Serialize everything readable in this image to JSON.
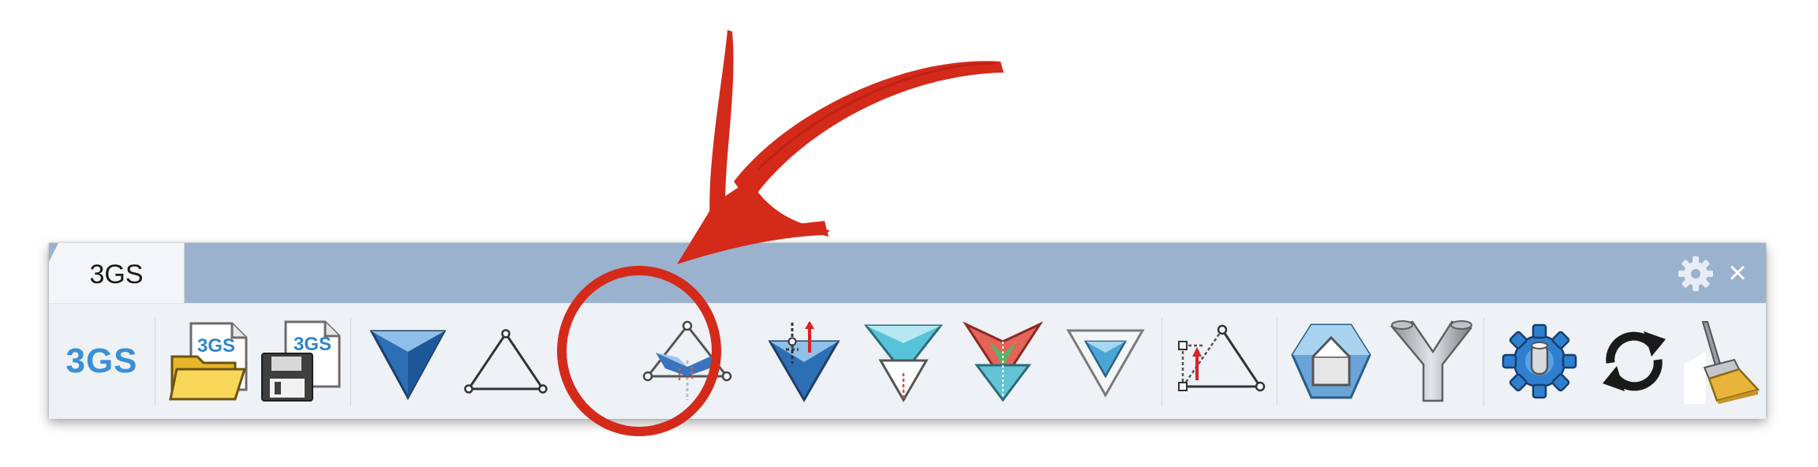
{
  "tab": {
    "label": "3GS"
  },
  "toolbar": {
    "logo_text": "3GS"
  },
  "icons": {
    "open_file_badge": "3GS",
    "save_file_badge": "3GS"
  },
  "colors": {
    "titlebar": "#9bb2cf",
    "logo": "#3a8fd6",
    "annotation_red": "#d42a1a"
  },
  "tools": [
    "3gs-logo-icon",
    "open-file-icon",
    "save-file-icon",
    "blue-triangle-icon",
    "triangle-outline-icon",
    "tent-triangle-icon",
    "blue-triangle-loads-icon",
    "cyan-triangle-icon",
    "red-green-triangle-icon",
    "nested-triangle-icon",
    "dimension-triangle-icon",
    "hexagon-box-icon",
    "y-pipe-icon",
    "blue-gear-icon",
    "refresh-icon",
    "broom-icon"
  ]
}
